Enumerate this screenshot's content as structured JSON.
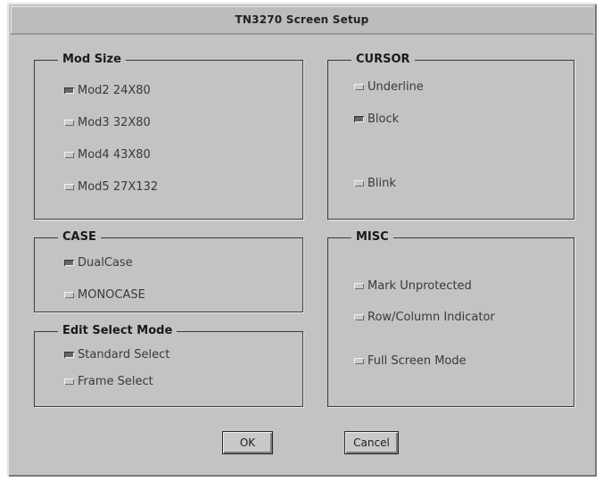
{
  "window": {
    "title": "TN3270 Screen Setup"
  },
  "mod_size": {
    "label": "Mod Size",
    "options": [
      {
        "label": "Mod2 24X80",
        "selected": true
      },
      {
        "label": "Mod3 32X80",
        "selected": false
      },
      {
        "label": "Mod4 43X80",
        "selected": false
      },
      {
        "label": "Mod5 27X132",
        "selected": false
      }
    ]
  },
  "cursor": {
    "label": "CURSOR",
    "options": [
      {
        "label": "Underline",
        "selected": false
      },
      {
        "label": "Block",
        "selected": true
      },
      {
        "label": "Blink",
        "selected": false
      }
    ]
  },
  "case": {
    "label": "CASE",
    "options": [
      {
        "label": "DualCase",
        "selected": true
      },
      {
        "label": "MONOCASE",
        "selected": false
      }
    ]
  },
  "misc": {
    "label": "MISC",
    "options": [
      {
        "label": "Mark Unprotected",
        "selected": false
      },
      {
        "label": "Row/Column Indicator",
        "selected": false
      },
      {
        "label": "Full Screen Mode",
        "selected": false
      }
    ]
  },
  "edit_select": {
    "label": "Edit Select Mode",
    "options": [
      {
        "label": "Standard Select",
        "selected": true
      },
      {
        "label": "Frame Select",
        "selected": false
      }
    ]
  },
  "buttons": {
    "ok": "OK",
    "cancel": "Cancel"
  }
}
